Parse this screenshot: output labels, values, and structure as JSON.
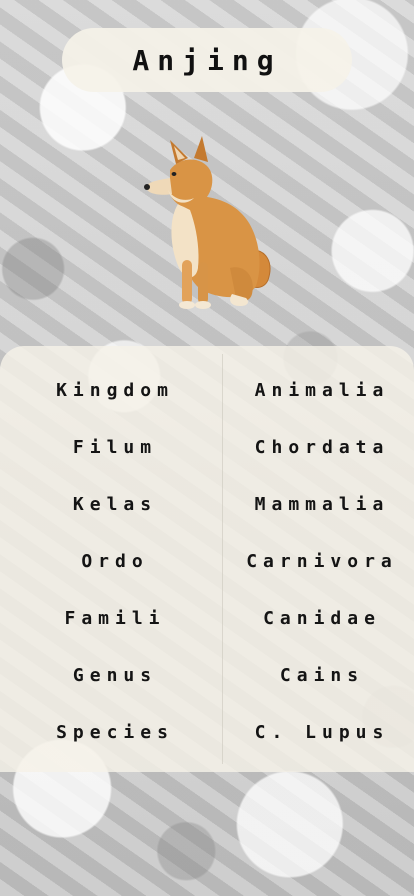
{
  "header": {
    "title": "Anjing"
  },
  "image": {
    "subject": "dog-photo"
  },
  "taxonomy": {
    "rows": [
      {
        "rank": "Kingdom",
        "value": "Animalia"
      },
      {
        "rank": "Filum",
        "value": "Chordata"
      },
      {
        "rank": "Kelas",
        "value": "Mammalia"
      },
      {
        "rank": "Ordo",
        "value": "Carnivora"
      },
      {
        "rank": "Famili",
        "value": "Canidae"
      },
      {
        "rank": "Genus",
        "value": "Cains"
      },
      {
        "rank": "Species",
        "value": "C. Lupus"
      }
    ]
  },
  "colors": {
    "panel_bg": "#f5f2e8",
    "text": "#141414"
  }
}
